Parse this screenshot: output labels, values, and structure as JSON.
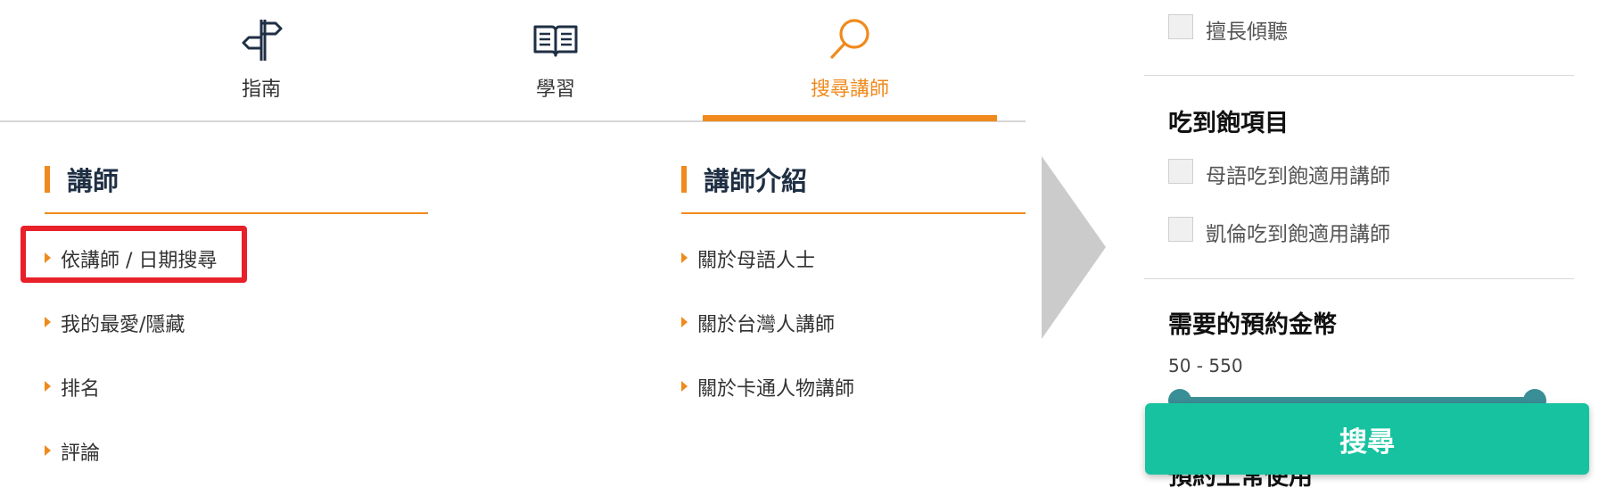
{
  "nav": {
    "tabs": [
      {
        "label": "指南",
        "icon": "signpost-icon"
      },
      {
        "label": "學習",
        "icon": "book-icon"
      },
      {
        "label": "搜尋講師",
        "icon": "search-icon",
        "active": true
      }
    ]
  },
  "sections": {
    "teachers": {
      "title": "講師",
      "links": [
        "依講師 / 日期搜尋",
        "我的最愛/隱藏",
        "排名",
        "評論"
      ]
    },
    "intro": {
      "title": "講師介紹",
      "links": [
        "關於母語人士",
        "關於台灣人講師",
        "關於卡通人物講師"
      ]
    }
  },
  "filters": {
    "top_checkbox": "擅長傾聽",
    "buffet": {
      "title": "吃到飽項目",
      "options": [
        "母語吃到飽適用講師",
        "凱倫吃到飽適用講師"
      ]
    },
    "coins": {
      "title": "需要的預約金幣",
      "range_text": "50 - 550",
      "min": 50,
      "max": 550
    },
    "partial_heading": "預約上常使用"
  },
  "search_button": "搜尋",
  "colors": {
    "accent_orange": "#f08a1c",
    "highlight_red": "#e8202a",
    "button_teal": "#17c2a0",
    "slider_teal": "#3a8e96",
    "heading_navy": "#1f2f44"
  }
}
